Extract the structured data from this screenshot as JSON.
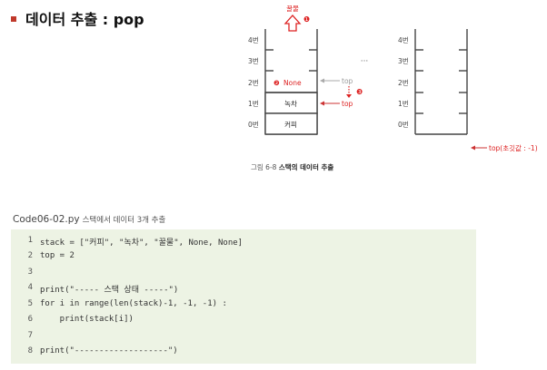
{
  "slide": {
    "title": "데이터 추출 : pop"
  },
  "figure": {
    "pop_label": "꿀물",
    "stack_labels": [
      "4번",
      "3번",
      "2번",
      "1번",
      "0번"
    ],
    "left_cells": [
      "",
      "",
      "None",
      "녹차",
      "커피"
    ],
    "step_badges": [
      "❶",
      "❷",
      "❸"
    ],
    "top_old": "top",
    "top_new": "top",
    "ellipsis": "···",
    "top_initial": "top(초깃값 : -1)",
    "caption_num": "그림 6-8",
    "caption_text": "스택의 데이터 추출"
  },
  "code": {
    "file": "Code06-02.py",
    "desc": "스택에서 데이터 3개 추출",
    "lines": [
      {
        "n": "1",
        "t": "stack = [\"커피\", \"녹차\", \"꿀물\", None, None]"
      },
      {
        "n": "2",
        "t": "top = 2"
      },
      {
        "n": "3",
        "t": ""
      },
      {
        "n": "4",
        "t": "print(\"----- 스택 상태 -----\")"
      },
      {
        "n": "5",
        "t": "for i in range(len(stack)-1, -1, -1) :"
      },
      {
        "n": "6",
        "t": "    print(stack[i])"
      },
      {
        "n": "7",
        "t": ""
      },
      {
        "n": "8",
        "t": "print(\"-------------------\")"
      }
    ]
  },
  "colors": {
    "accent": "#c0392b",
    "code_bg": "#edf3e4"
  }
}
